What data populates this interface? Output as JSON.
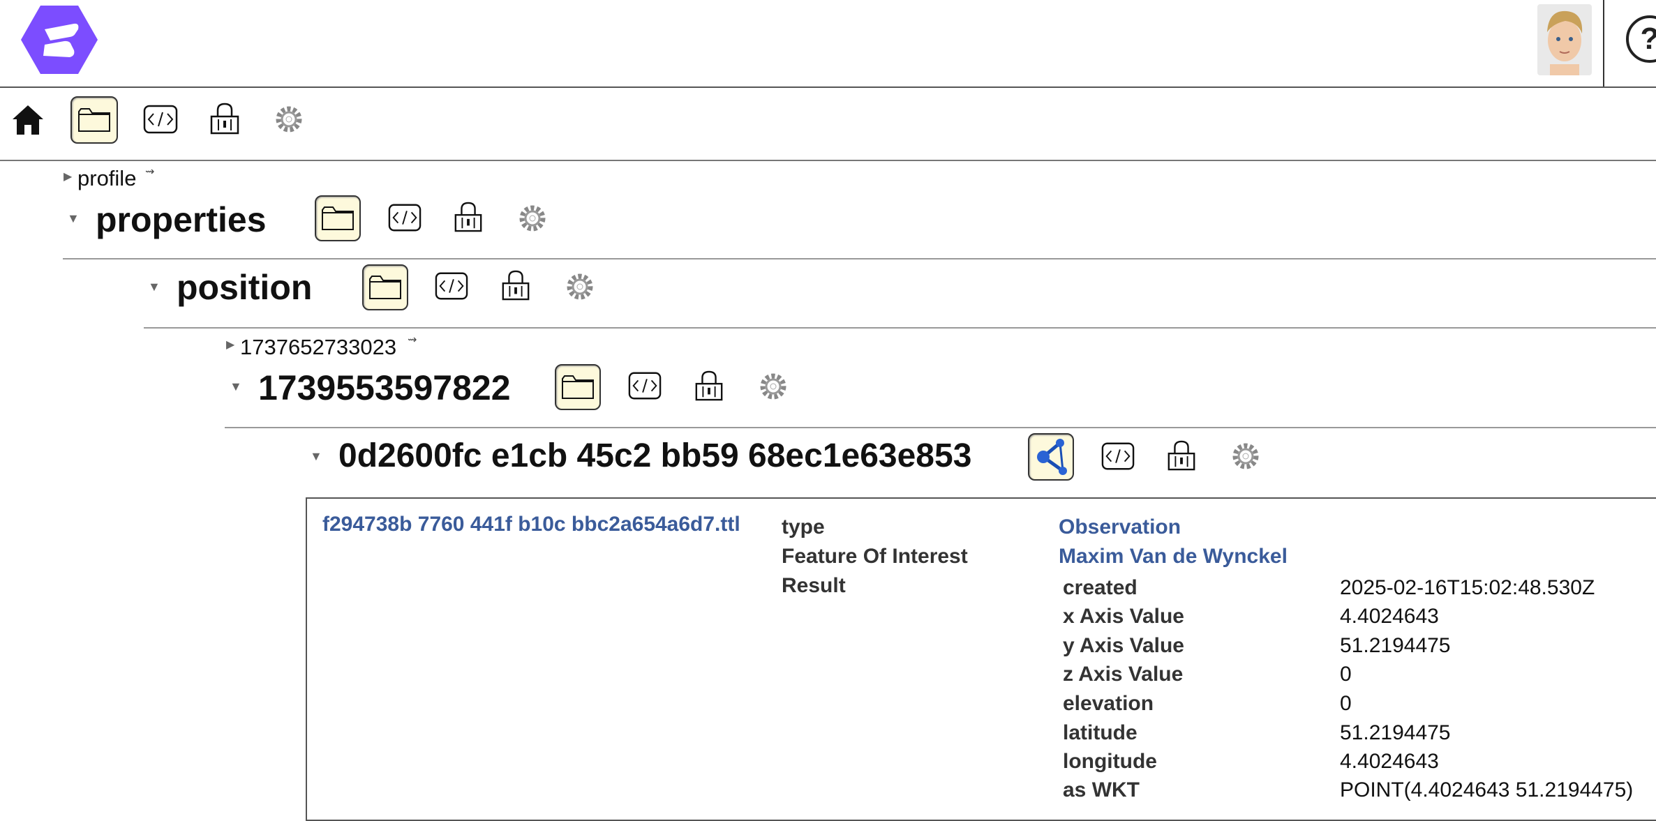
{
  "header": {
    "logo_icon": "solid-logo-icon",
    "avatar_icon": "user-avatar-icon",
    "help_label": "?"
  },
  "colors": {
    "accent": "#7c4dff",
    "active_bg": "#fdf9dc",
    "link": "#3a5b9a"
  },
  "toolbar": {
    "icons": [
      "home-icon",
      "folder-icon",
      "code-icon",
      "lock-icon",
      "gear-icon"
    ]
  },
  "tree": {
    "profile": {
      "label": "profile"
    },
    "properties": {
      "label": "properties"
    },
    "position": {
      "label": "position"
    },
    "ts1": {
      "label": "1737652733023"
    },
    "ts2": {
      "label": "1739553597822"
    },
    "resource": {
      "label": "0d2600fc e1cb 45c2 bb59 68ec1e63e853"
    }
  },
  "observation": {
    "file": "f294738b 7760 441f b10c bbc2a654a6d7.ttl",
    "rows": [
      {
        "key": "type",
        "value": "Observation"
      },
      {
        "key": "Feature Of Interest",
        "value": "Maxim Van de Wynckel"
      },
      {
        "key": "Result",
        "value": ""
      }
    ],
    "result": [
      {
        "key": "created",
        "value": "2025-02-16T15:02:48.530Z"
      },
      {
        "key": "x Axis Value",
        "value": "4.4024643"
      },
      {
        "key": "y Axis Value",
        "value": "51.2194475"
      },
      {
        "key": "z Axis Value",
        "value": "0"
      },
      {
        "key": "elevation",
        "value": "0"
      },
      {
        "key": "latitude",
        "value": "51.2194475"
      },
      {
        "key": "longitude",
        "value": "4.4024643"
      },
      {
        "key": "as WKT",
        "value": "POINT(4.4024643 51.2194475)"
      }
    ]
  }
}
